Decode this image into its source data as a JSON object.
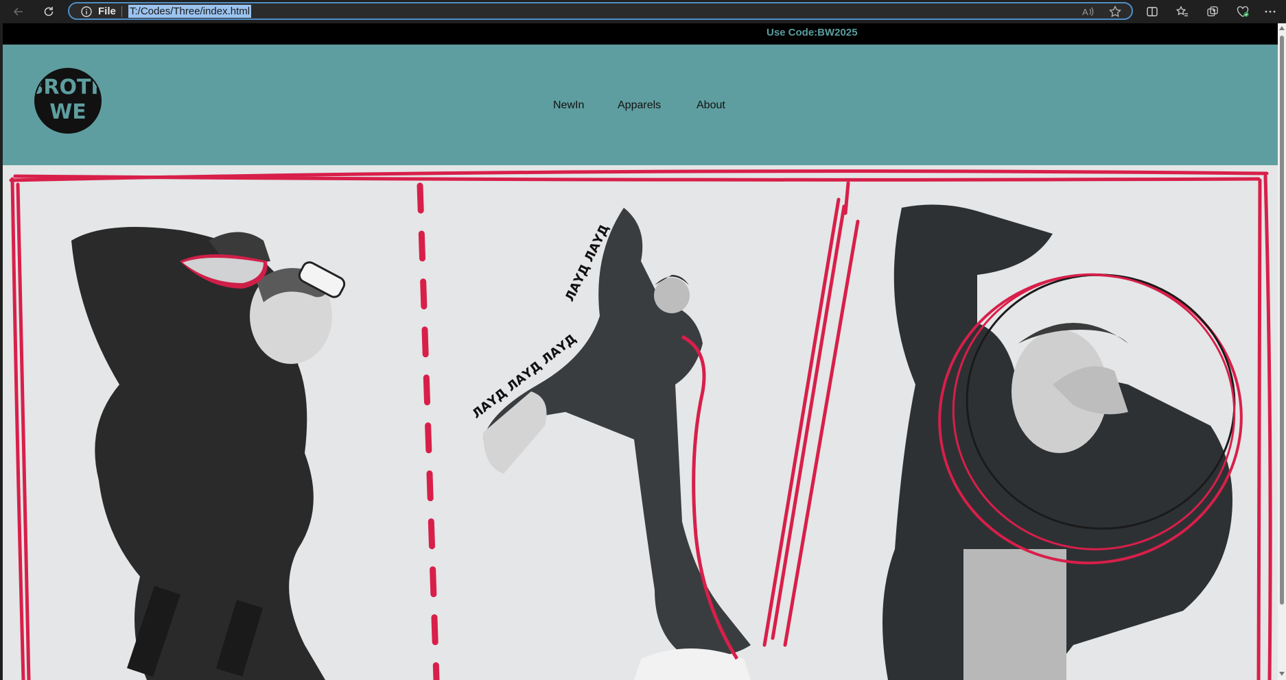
{
  "browser": {
    "address_prefix": "File",
    "url": "T:/Codes/Three/index.html"
  },
  "promo": {
    "text": "Use Code:BW2025"
  },
  "nav": {
    "items": [
      "NewIn",
      "Apparels",
      "About"
    ]
  },
  "logo": {
    "text": "BROTH WE"
  },
  "colors": {
    "header_bg": "#5f9ea0",
    "promo_bg": "#000000",
    "promo_text": "#5b9ea1",
    "sketch_red": "#d81f4a"
  }
}
